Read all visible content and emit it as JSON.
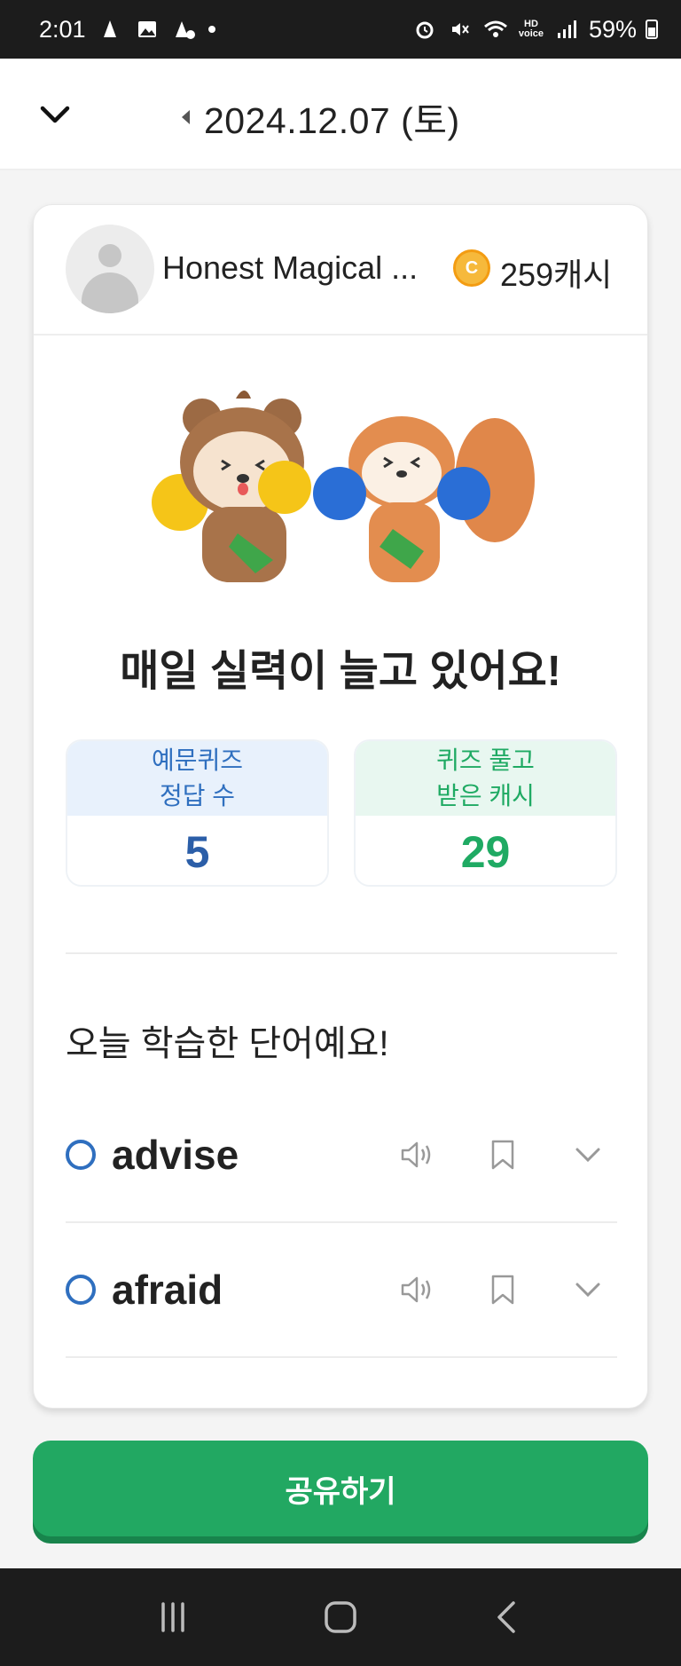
{
  "status_bar": {
    "time": "2:01",
    "battery": "59%"
  },
  "header": {
    "date": "2024.12.07 (토)"
  },
  "profile": {
    "name": "Honest Magical ...",
    "cash": "259캐시"
  },
  "headline": "매일 실력이 늘고 있어요!",
  "stats": [
    {
      "label_line1": "예문퀴즈",
      "label_line2": "정답 수",
      "value": "5"
    },
    {
      "label_line1": "퀴즈 풀고",
      "label_line2": "받은 캐시",
      "value": "29"
    }
  ],
  "section_title": "오늘 학습한 단어예요!",
  "words": [
    {
      "word": "advise"
    },
    {
      "word": "afraid"
    }
  ],
  "share_label": "공유하기",
  "colors": {
    "accent_green": "#22a862",
    "accent_blue": "#2f6fbf"
  },
  "icons": [
    "chevron-down-icon",
    "triangle-left-icon",
    "coin-icon",
    "speaker-icon",
    "bookmark-icon",
    "recent-apps-icon",
    "home-icon",
    "back-icon"
  ]
}
